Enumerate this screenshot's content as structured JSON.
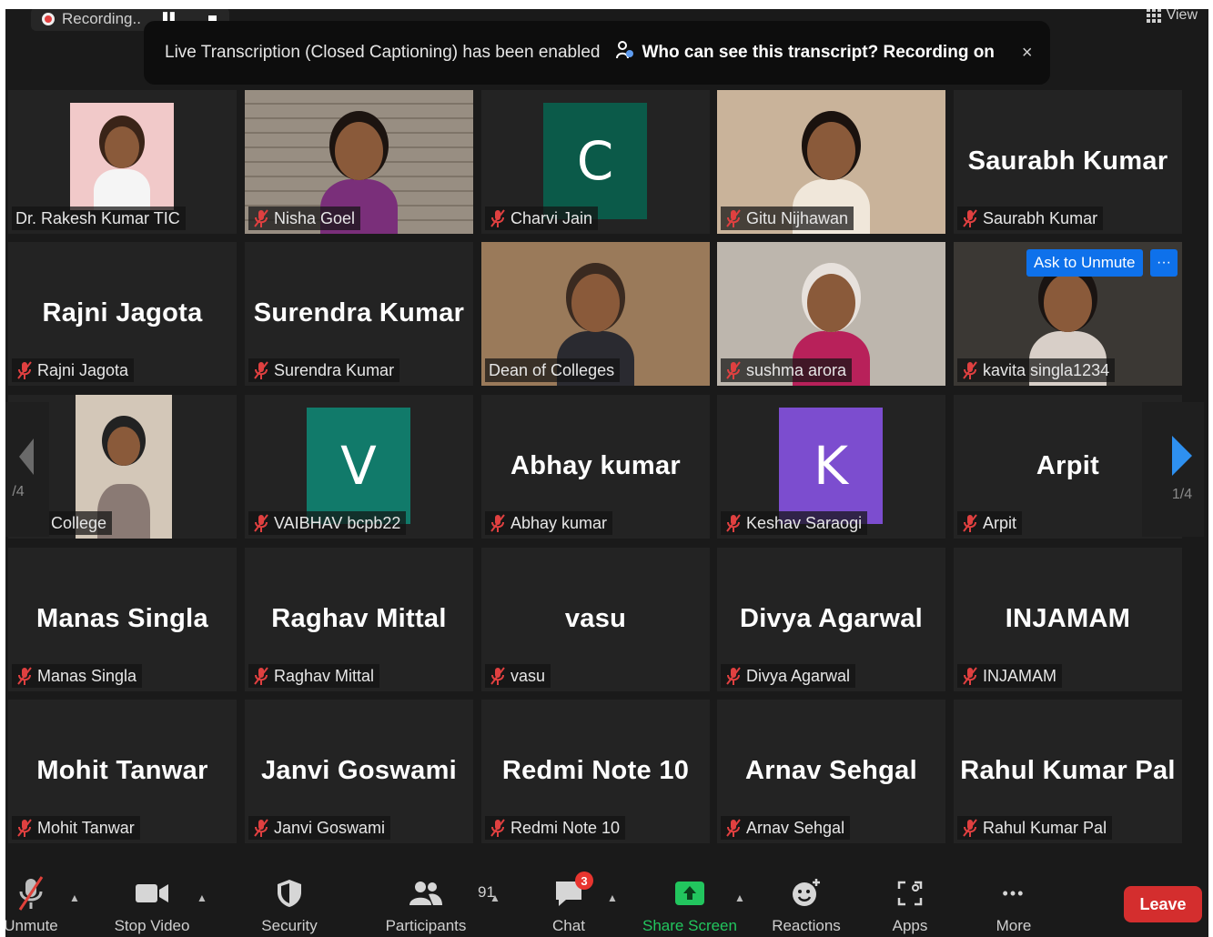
{
  "topbar": {
    "recording_label": "Recording..",
    "view_label": "View"
  },
  "banner": {
    "message": "Live Transcription (Closed Captioning) has been enabled",
    "link": "Who can see this transcript? Recording on",
    "close_glyph": "×"
  },
  "tiles": [
    {
      "label": "Dr. Rakesh Kumar TIC",
      "big": "",
      "muted": false
    },
    {
      "label": "Nisha Goel",
      "big": "",
      "muted": true
    },
    {
      "label": "Charvi Jain",
      "big": "",
      "avatar_letter": "C",
      "avatar_color": "#0b5a49",
      "muted": true
    },
    {
      "label": "Gitu Nijhawan",
      "big": "",
      "muted": true
    },
    {
      "label": "Saurabh Kumar",
      "big": "Saurabh Kumar",
      "muted": true
    },
    {
      "label": "Rajni Jagota",
      "big": "Rajni Jagota",
      "muted": true
    },
    {
      "label": "Surendra Kumar",
      "big": "Surendra Kumar",
      "muted": true
    },
    {
      "label": "Dean of Colleges",
      "big": "",
      "muted": false,
      "speaking": true
    },
    {
      "label": "sushma arora",
      "big": "",
      "muted": true
    },
    {
      "label": "kavita singla1234",
      "big": "",
      "muted": true,
      "ask_to_unmute": "Ask to Unmute",
      "more": "···"
    },
    {
      "label": "ıdav College",
      "big": "",
      "muted": false
    },
    {
      "label": "VAIBHAV bcpb22",
      "big": "",
      "avatar_letter": "V",
      "avatar_color": "#117a6a",
      "muted": true
    },
    {
      "label": "Abhay kumar",
      "big": "Abhay kumar",
      "muted": true
    },
    {
      "label": "Keshav Saraogi",
      "big": "",
      "avatar_letter": "K",
      "avatar_color": "#7c4dcf",
      "muted": true
    },
    {
      "label": "Arpit",
      "big": "Arpit",
      "muted": true
    },
    {
      "label": "Manas Singla",
      "big": "Manas Singla",
      "muted": true
    },
    {
      "label": "Raghav Mittal",
      "big": "Raghav Mittal",
      "muted": true
    },
    {
      "label": "vasu",
      "big": "vasu",
      "muted": true
    },
    {
      "label": "Divya Agarwal",
      "big": "Divya Agarwal",
      "muted": true
    },
    {
      "label": "INJAMAM",
      "big": "INJAMAM",
      "muted": true
    },
    {
      "label": "Mohit Tanwar",
      "big": "Mohit Tanwar",
      "muted": true
    },
    {
      "label": "Janvi Goswami",
      "big": "Janvi Goswami",
      "muted": true
    },
    {
      "label": "Redmi Note 10",
      "big": "Redmi Note 10",
      "muted": true
    },
    {
      "label": "Arnav Sehgal",
      "big": "Arnav Sehgal",
      "muted": true
    },
    {
      "label": "Rahul Kumar Pal",
      "big": "Rahul Kumar Pal",
      "muted": true
    }
  ],
  "pagination": {
    "left_label": "/4",
    "right_label": "1/4"
  },
  "toolbar": {
    "unmute": "Unmute",
    "stop_video": "Stop Video",
    "security": "Security",
    "participants": "Participants",
    "participants_count": "91",
    "chat": "Chat",
    "chat_badge": "3",
    "share_screen": "Share Screen",
    "reactions": "Reactions",
    "apps": "Apps",
    "more": "More",
    "more_glyph": "•••",
    "leave": "Leave"
  },
  "colors": {
    "accent_green": "#22c55e",
    "leave_red": "#d42e2e",
    "speaking_outline": "#c6e06d",
    "ask_blue": "#0e71eb"
  }
}
